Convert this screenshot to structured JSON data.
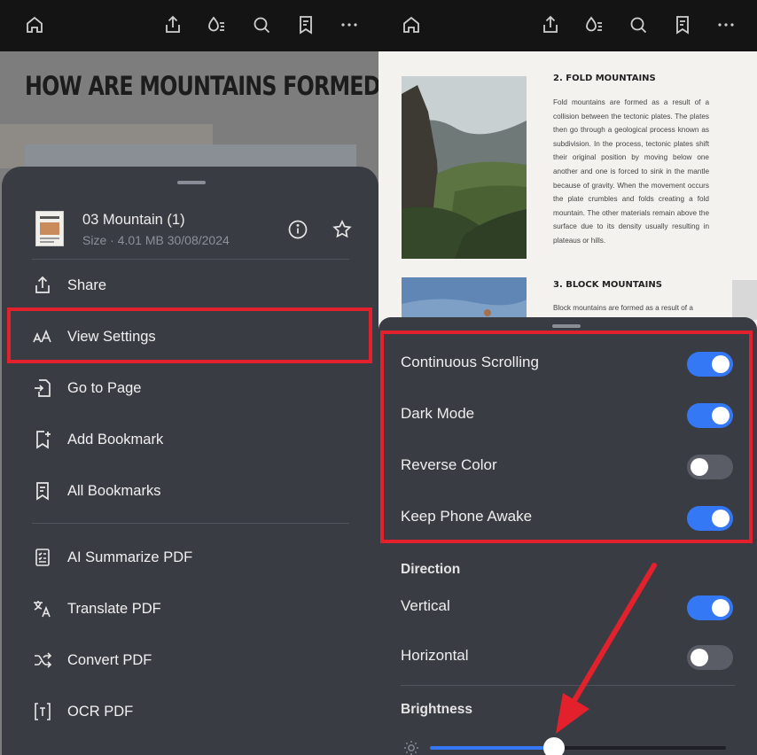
{
  "left": {
    "document_title": "HOW ARE MOUNTAINS FORMED?",
    "file": {
      "name": "03 Mountain (1)",
      "meta": "Size · 4.01 MB 30/08/2024"
    },
    "menu": [
      {
        "label": "Share",
        "icon": "share-icon"
      },
      {
        "label": "View Settings",
        "icon": "text-size-icon"
      },
      {
        "label": "Go to Page",
        "icon": "go-to-page-icon"
      },
      {
        "label": "Add Bookmark",
        "icon": "add-bookmark-icon"
      },
      {
        "label": "All Bookmarks",
        "icon": "bookmarks-list-icon"
      },
      {
        "label": "AI Summarize PDF",
        "icon": "summarize-icon"
      },
      {
        "label": "Translate PDF",
        "icon": "translate-icon"
      },
      {
        "label": "Convert PDF",
        "icon": "convert-icon"
      },
      {
        "label": "OCR PDF",
        "icon": "ocr-icon"
      }
    ]
  },
  "right": {
    "page": {
      "heading1": "2. FOLD MOUNTAINS",
      "paragraph1": "Fold mountains are formed as a result of a collision between the tectonic plates. The plates then go through a geological process known as subdivision. In the process, tectonic plates shift their original position by moving below one another and one is forced to sink in the mantle because of gravity. When the movement occurs the plate crumbles and folds creating a fold mountain. The other materials remain above the surface due to its density usually resulting in plateaus or hills.",
      "heading2": "3. BLOCK MOUNTAINS",
      "paragraph2": "Block mountains are formed as a result of a"
    },
    "settings": [
      {
        "label": "Continuous Scrolling",
        "on": true
      },
      {
        "label": "Dark Mode",
        "on": true
      },
      {
        "label": "Reverse Color",
        "on": false
      },
      {
        "label": "Keep Phone Awake",
        "on": true
      }
    ],
    "direction_heading": "Direction",
    "direction": [
      {
        "label": "Vertical",
        "on": true
      },
      {
        "label": "Horizontal",
        "on": false
      }
    ],
    "brightness_heading": "Brightness",
    "brightness_level": 0.42
  },
  "colors": {
    "accent": "#3478f6",
    "highlight": "#e3212d",
    "sheet": "#3a3c44",
    "toolbar": "#141414"
  }
}
